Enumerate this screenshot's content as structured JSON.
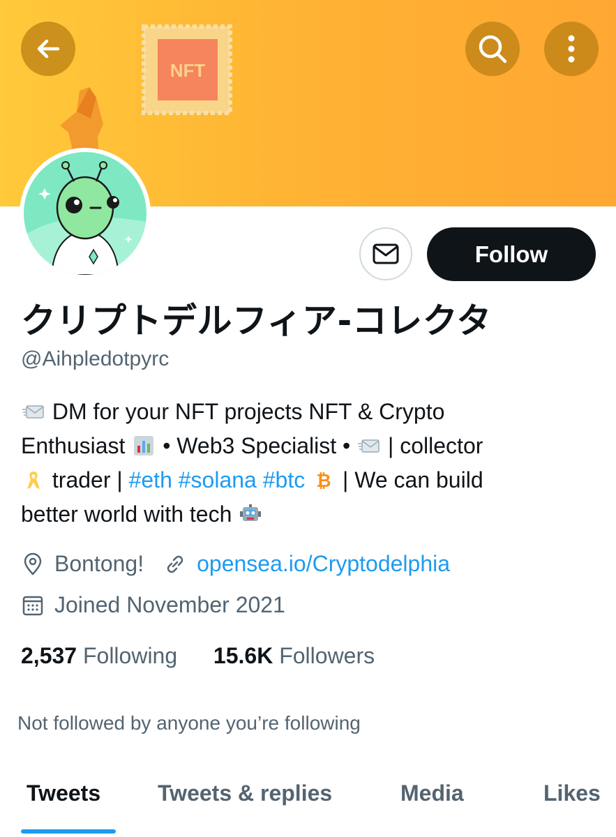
{
  "banner": {
    "stamp_text": "NFT",
    "colors": {
      "banner": "#ffb433",
      "stamp": "#f6845c"
    }
  },
  "header": {
    "back_icon": "arrow-left-icon",
    "search_icon": "search-icon",
    "more_icon": "more-vertical-icon"
  },
  "actions": {
    "message_icon": "envelope-icon",
    "follow_label": "Follow"
  },
  "profile": {
    "display_name": "クリプトデルフィア-コレクタ",
    "handle": "@Aihpledotpyrc",
    "bio": {
      "line1_text": "DM for your NFT projects NFT & Crypto",
      "line2_a": "Enthusiast",
      "line2_b": "• Web3 Specialist •",
      "line2_c": "| collector",
      "line3_a": "trader |",
      "line3_tags": "#eth #solana #btc",
      "line3_b": "| We can build",
      "line4_text": "better world with tech"
    },
    "location": "Bontong!",
    "website": "opensea.io/Cryptodelphia",
    "joined": "Joined November 2021"
  },
  "stats": {
    "following_count": "2,537",
    "following_label": "Following",
    "followers_count": "15.6K",
    "followers_label": "Followers"
  },
  "social_context": "Not followed by anyone you’re following",
  "tabs": [
    {
      "label": "Tweets",
      "active": true
    },
    {
      "label": "Tweets & replies",
      "active": false
    },
    {
      "label": "Media",
      "active": false
    },
    {
      "label": "Likes",
      "active": false
    }
  ],
  "colors": {
    "accent": "#1d9bf0",
    "text_primary": "#0f1419",
    "text_secondary": "#536471"
  }
}
